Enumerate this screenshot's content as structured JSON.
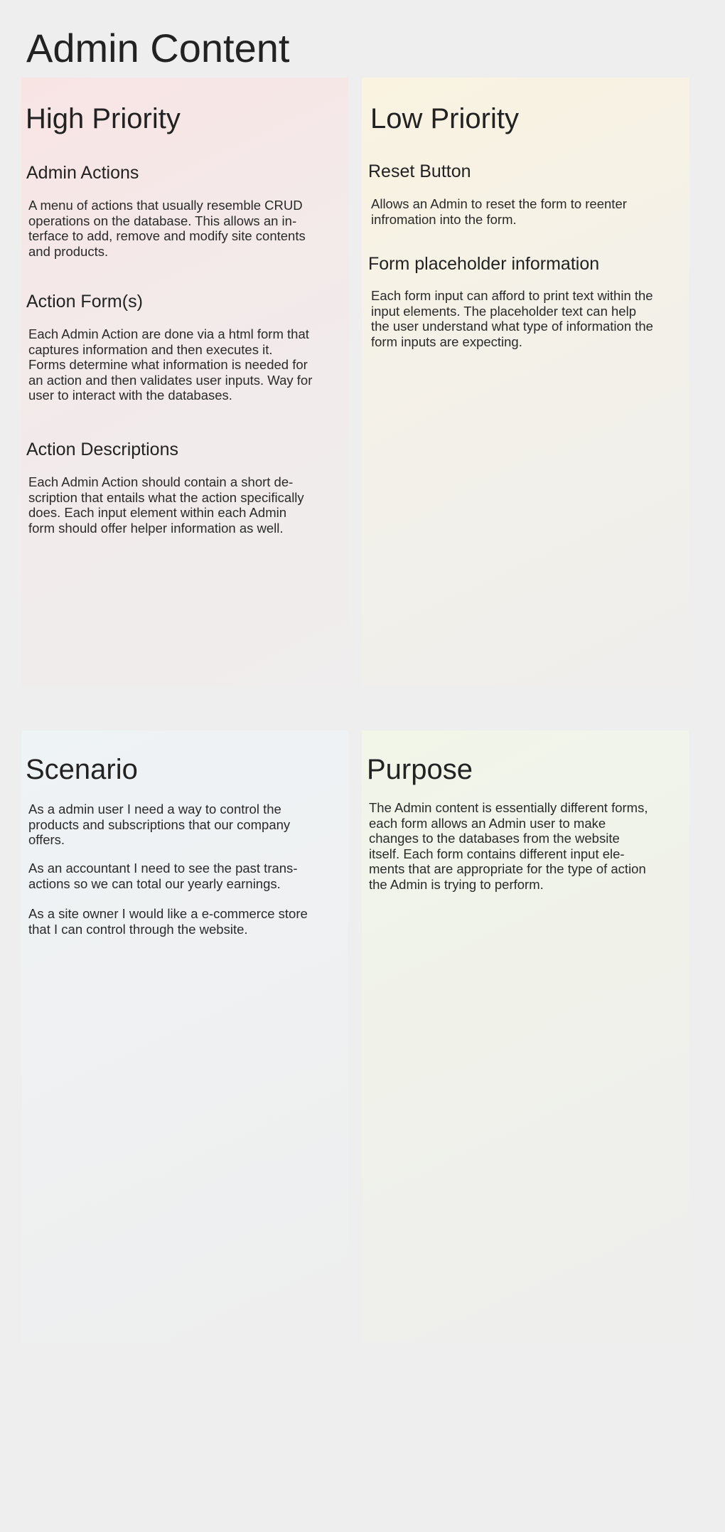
{
  "page": {
    "title": "Admin Content"
  },
  "high_priority": {
    "title": "High Priority",
    "sections": [
      {
        "title": "Admin Actions",
        "text": "A menu of actions that usually resemble CRUD operations on the database. This allows an in­terface to add, remove and modify site contents and products."
      },
      {
        "title": "Action Form(s)",
        "text": "Each Admin Action are done via a html form that captures information and then executes it. Forms determine what information is needed for an action and then validates user inputs. Way for user to interact with the databases."
      },
      {
        "title": "Action Descriptions",
        "text": "Each Admin Action should contain a short de­scription that entails what the action specifically does. Each input element within each Admin form should offer helper information as well."
      }
    ]
  },
  "low_priority": {
    "title": "Low Priority",
    "sections": [
      {
        "title": "Reset Button",
        "text": "Allows an Admin to reset the form to reenter infromation into the form."
      },
      {
        "title": "Form placeholder information",
        "text": "Each form input can afford to print text within the input elements. The placeholder text can help the user understand what type of informa­tion the form inputs are expecting."
      }
    ]
  },
  "scenario": {
    "title": "Scenario",
    "paragraphs": [
      "As a admin user I need a way to control the products and subscriptions that our company offers.",
      "As an accountant I need to see the past trans­actions so we can total our yearly earnings.",
      "As a site owner I would like a e-commerce store that I can control through the website."
    ]
  },
  "purpose": {
    "title": "Purpose",
    "text": "The Admin content is essentially different forms, each form allows an Admin user to make changes to the databases from the website itself. Each form contains different input ele­ments that are appropriate for the type of action the Admin is trying to perform."
  }
}
